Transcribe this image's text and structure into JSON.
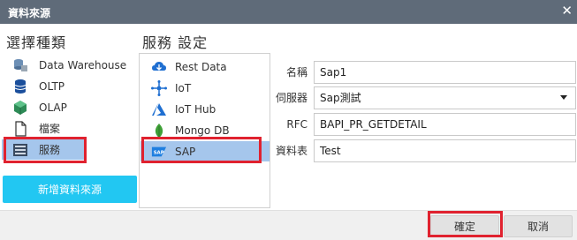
{
  "window": {
    "title": "資料來源"
  },
  "left": {
    "heading": "選擇種類",
    "items": [
      {
        "label": "Data Warehouse",
        "icon": "data-warehouse-icon"
      },
      {
        "label": "OLTP",
        "icon": "database-icon"
      },
      {
        "label": "OLAP",
        "icon": "cube-icon"
      },
      {
        "label": "檔案",
        "icon": "file-icon"
      },
      {
        "label": "服務",
        "icon": "service-icon",
        "selected": true
      }
    ],
    "add_button": "新增資料來源"
  },
  "middle": {
    "heading": "服務 設定",
    "items": [
      {
        "label": "Rest Data",
        "icon": "cloud-icon"
      },
      {
        "label": "IoT",
        "icon": "iot-icon"
      },
      {
        "label": "IoT Hub",
        "icon": "azure-icon"
      },
      {
        "label": "Mongo DB",
        "icon": "leaf-icon"
      },
      {
        "label": "SAP",
        "icon": "sap-icon",
        "selected": true
      }
    ]
  },
  "form": {
    "name_label": "名稱",
    "name_value": "Sap1",
    "server_label": "伺服器",
    "server_value": "Sap測試",
    "rfc_label": "RFC",
    "rfc_value": "BAPI_PR_GETDETAIL",
    "table_label": "資料表",
    "table_value": "Test"
  },
  "footer": {
    "ok": "確定",
    "cancel": "取消"
  },
  "colors": {
    "titlebar": "#5f6b79",
    "selection": "#a5c6ec",
    "accent": "#22c7f2",
    "highlight": "#e0222f"
  }
}
